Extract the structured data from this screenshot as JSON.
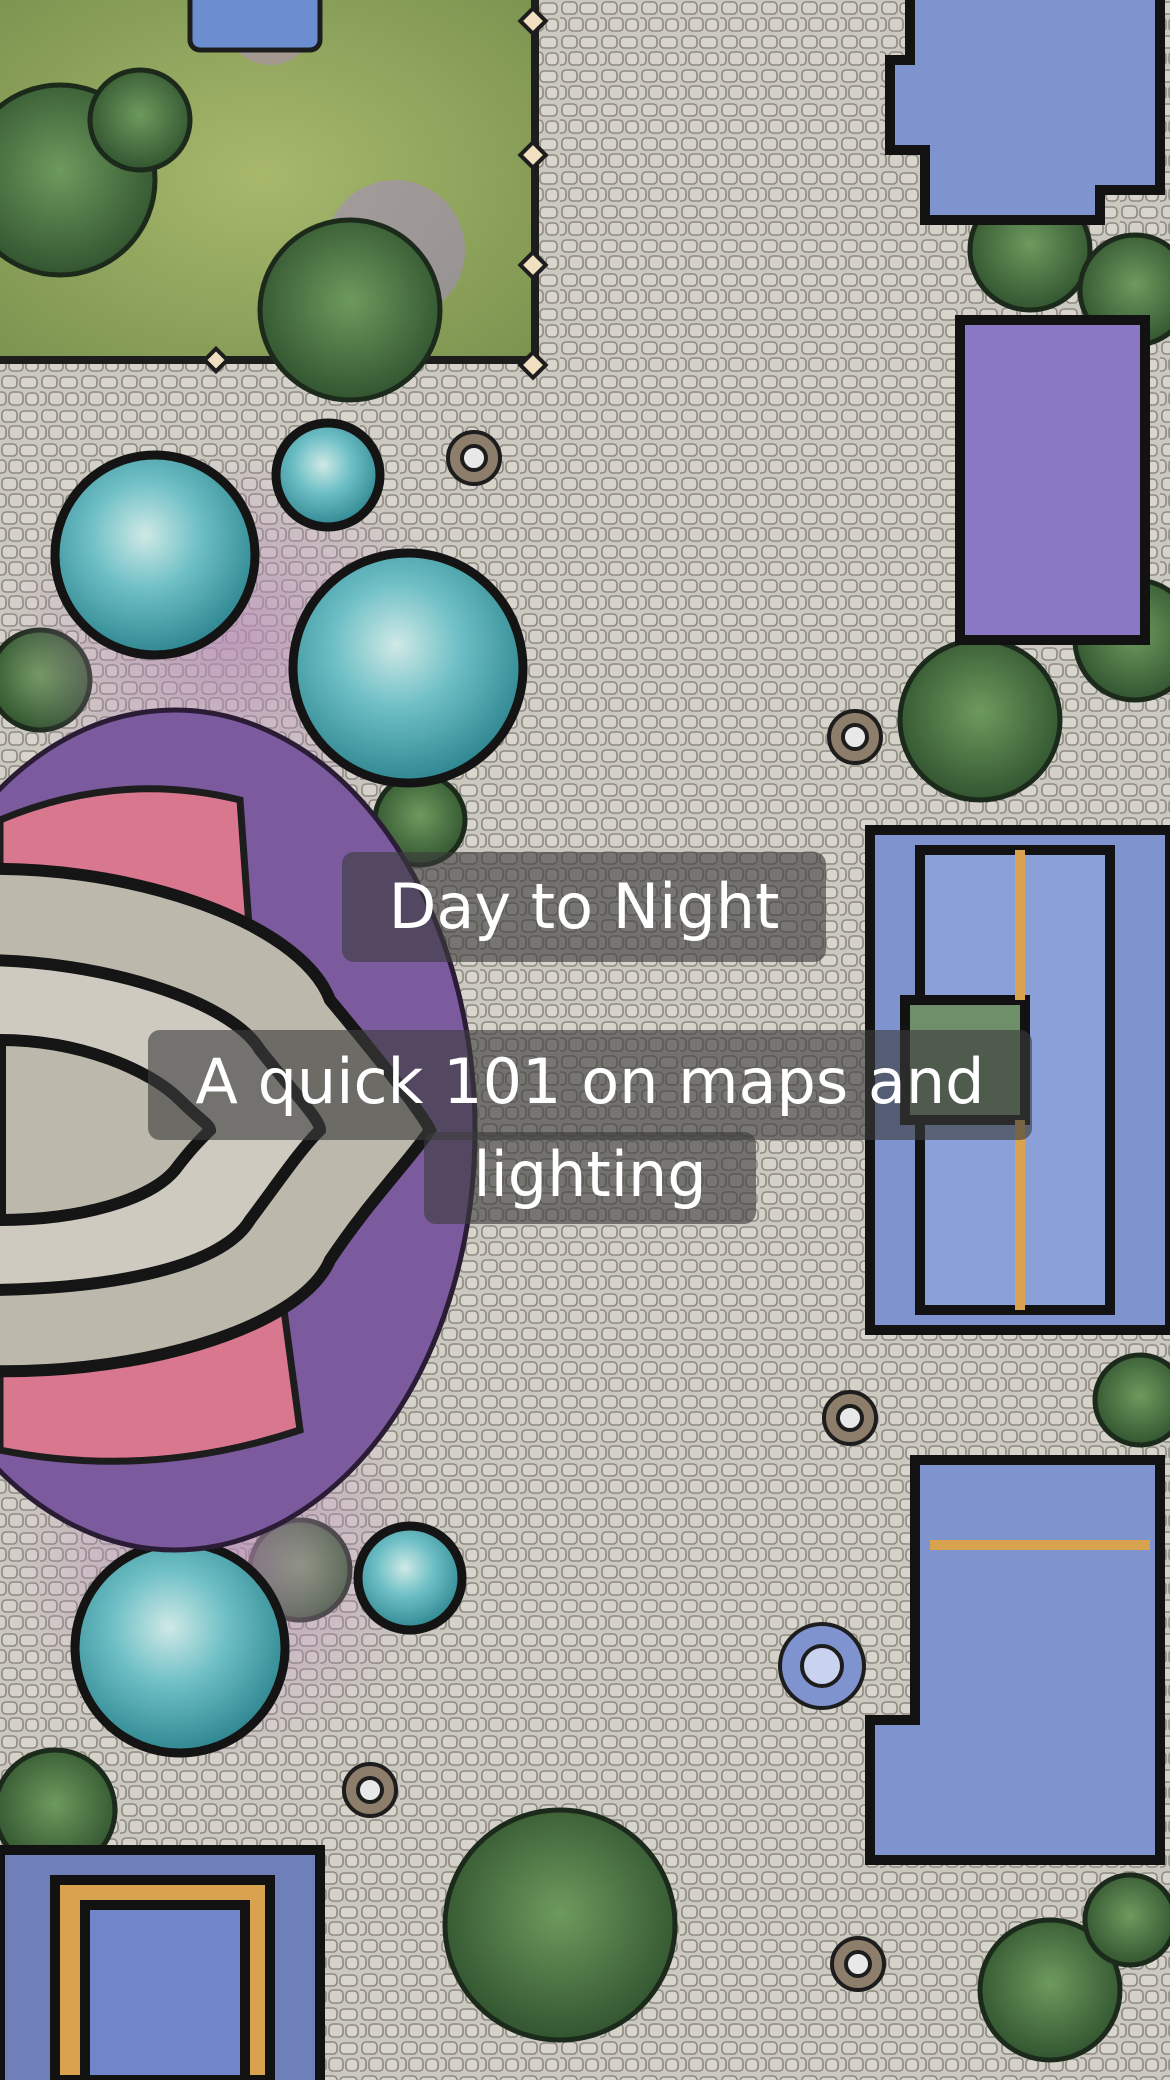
{
  "captions": {
    "title": "Day to Night",
    "subtitle_line1": "A quick 101 on maps and",
    "subtitle_line2": "lighting"
  },
  "colors": {
    "cobblestone": "#c9c6bd",
    "cobble_lines": "#8e8a82",
    "grass": "#8fa45a",
    "tree": "#3f6b3c",
    "pond": "#5bb4bd",
    "building_roof": "#7f93cf",
    "building_roof_purple": "#8a78c4",
    "gold_trim": "#d9a24f",
    "heart_stone": "#bdb8ac",
    "pink_canopy": "#d9778f",
    "purple_foliage": "#7b5a9e"
  }
}
